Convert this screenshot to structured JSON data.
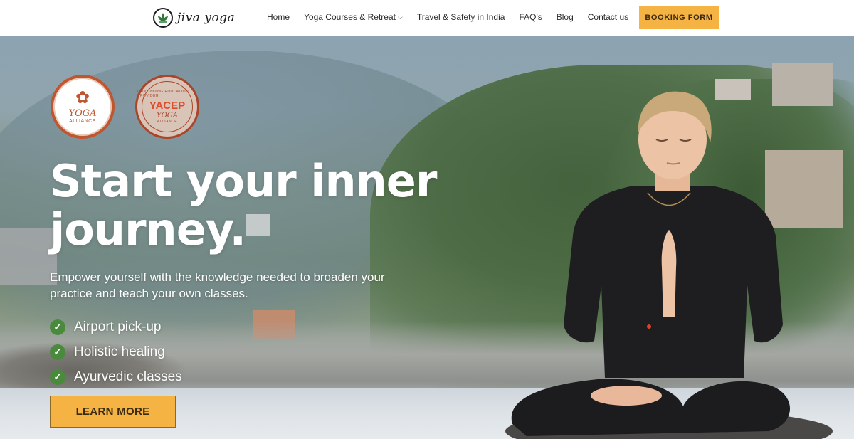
{
  "brand": {
    "name": "jiva yoga",
    "logo_icon": "lotus-icon"
  },
  "nav": {
    "items": [
      {
        "label": "Home"
      },
      {
        "label": "Yoga Courses & Retreat",
        "has_dropdown": true
      },
      {
        "label": "Travel & Safety in India"
      },
      {
        "label": "FAQ's"
      },
      {
        "label": "Blog"
      },
      {
        "label": "Contact us"
      }
    ],
    "cta": "BOOKING FORM"
  },
  "badges": {
    "yoga_alliance": {
      "line1": "YOGA",
      "line2": "ALLIANCE"
    },
    "yacep": {
      "ring_text": "CONTINUING EDUCATION PROVIDER",
      "title": "YACEP",
      "line1": "YOGA",
      "line2": "ALLIANCE"
    }
  },
  "hero": {
    "headline_line1": "Start your inner",
    "headline_line2": "journey.",
    "subtitle": "Empower yourself with the knowledge needed to broaden your practice and teach your own classes.",
    "features": [
      {
        "label": "Airport pick-up",
        "icon": "check-circle-icon"
      },
      {
        "label": "Holistic healing",
        "icon": "check-circle-icon"
      },
      {
        "label": "Ayurvedic classes",
        "icon": "check-circle-icon"
      }
    ],
    "cta": "LEARN MORE"
  },
  "colors": {
    "accent": "#f5b343",
    "check": "#4a8a3d",
    "badge_red": "#c0562f"
  }
}
